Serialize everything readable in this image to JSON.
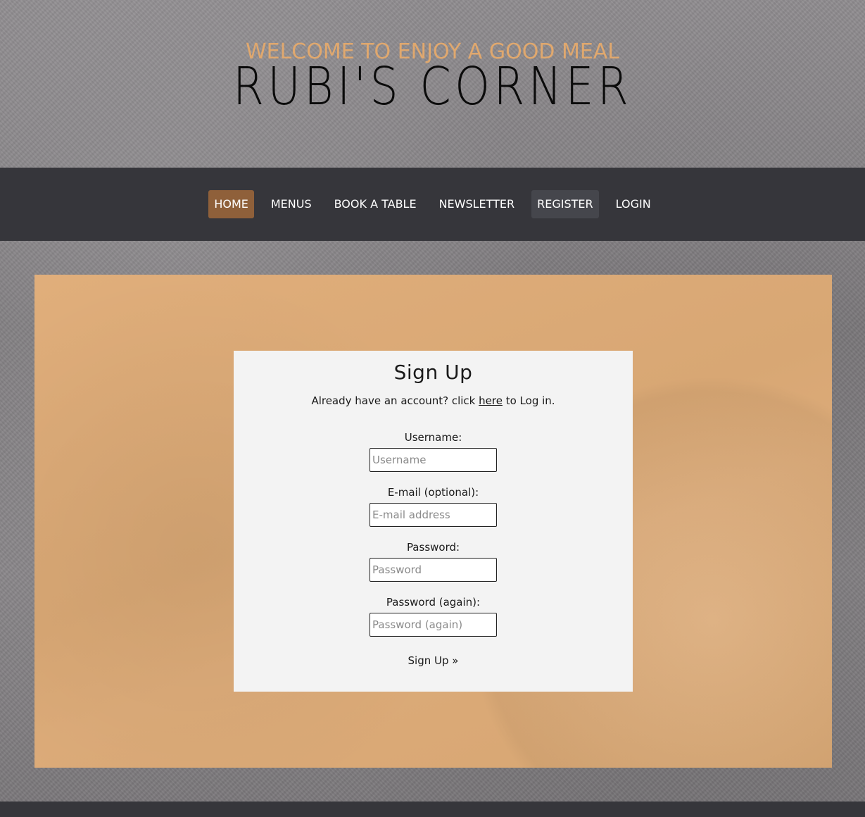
{
  "header": {
    "welcome": "WELCOME TO ENJOY A GOOD MEAL",
    "brand": "RUBI'S CORNER"
  },
  "nav": {
    "items": [
      {
        "label": "HOME",
        "state": "active"
      },
      {
        "label": "MENUS",
        "state": ""
      },
      {
        "label": "BOOK A TABLE",
        "state": ""
      },
      {
        "label": "NEWSLETTER",
        "state": ""
      },
      {
        "label": "REGISTER",
        "state": "current"
      },
      {
        "label": "LOGIN",
        "state": ""
      }
    ]
  },
  "signup": {
    "title": "Sign Up",
    "already_text": "Already have an account? click",
    "here_link": "here",
    "login_suffix": "to Log in.",
    "username_label": "Username:",
    "username_placeholder": "Username",
    "email_label": "E-mail (optional):",
    "email_placeholder": "E-mail address",
    "password_label": "Password:",
    "password_placeholder": "Password",
    "password2_label": "Password (again):",
    "password2_placeholder": "Password (again)",
    "submit_label": "Sign Up »"
  },
  "colors": {
    "welcome": "#e0a86e",
    "nav_bg": "#36363b",
    "nav_active": "#8f603a",
    "panel": "#dbaa77",
    "card": "#f3f3f3"
  }
}
